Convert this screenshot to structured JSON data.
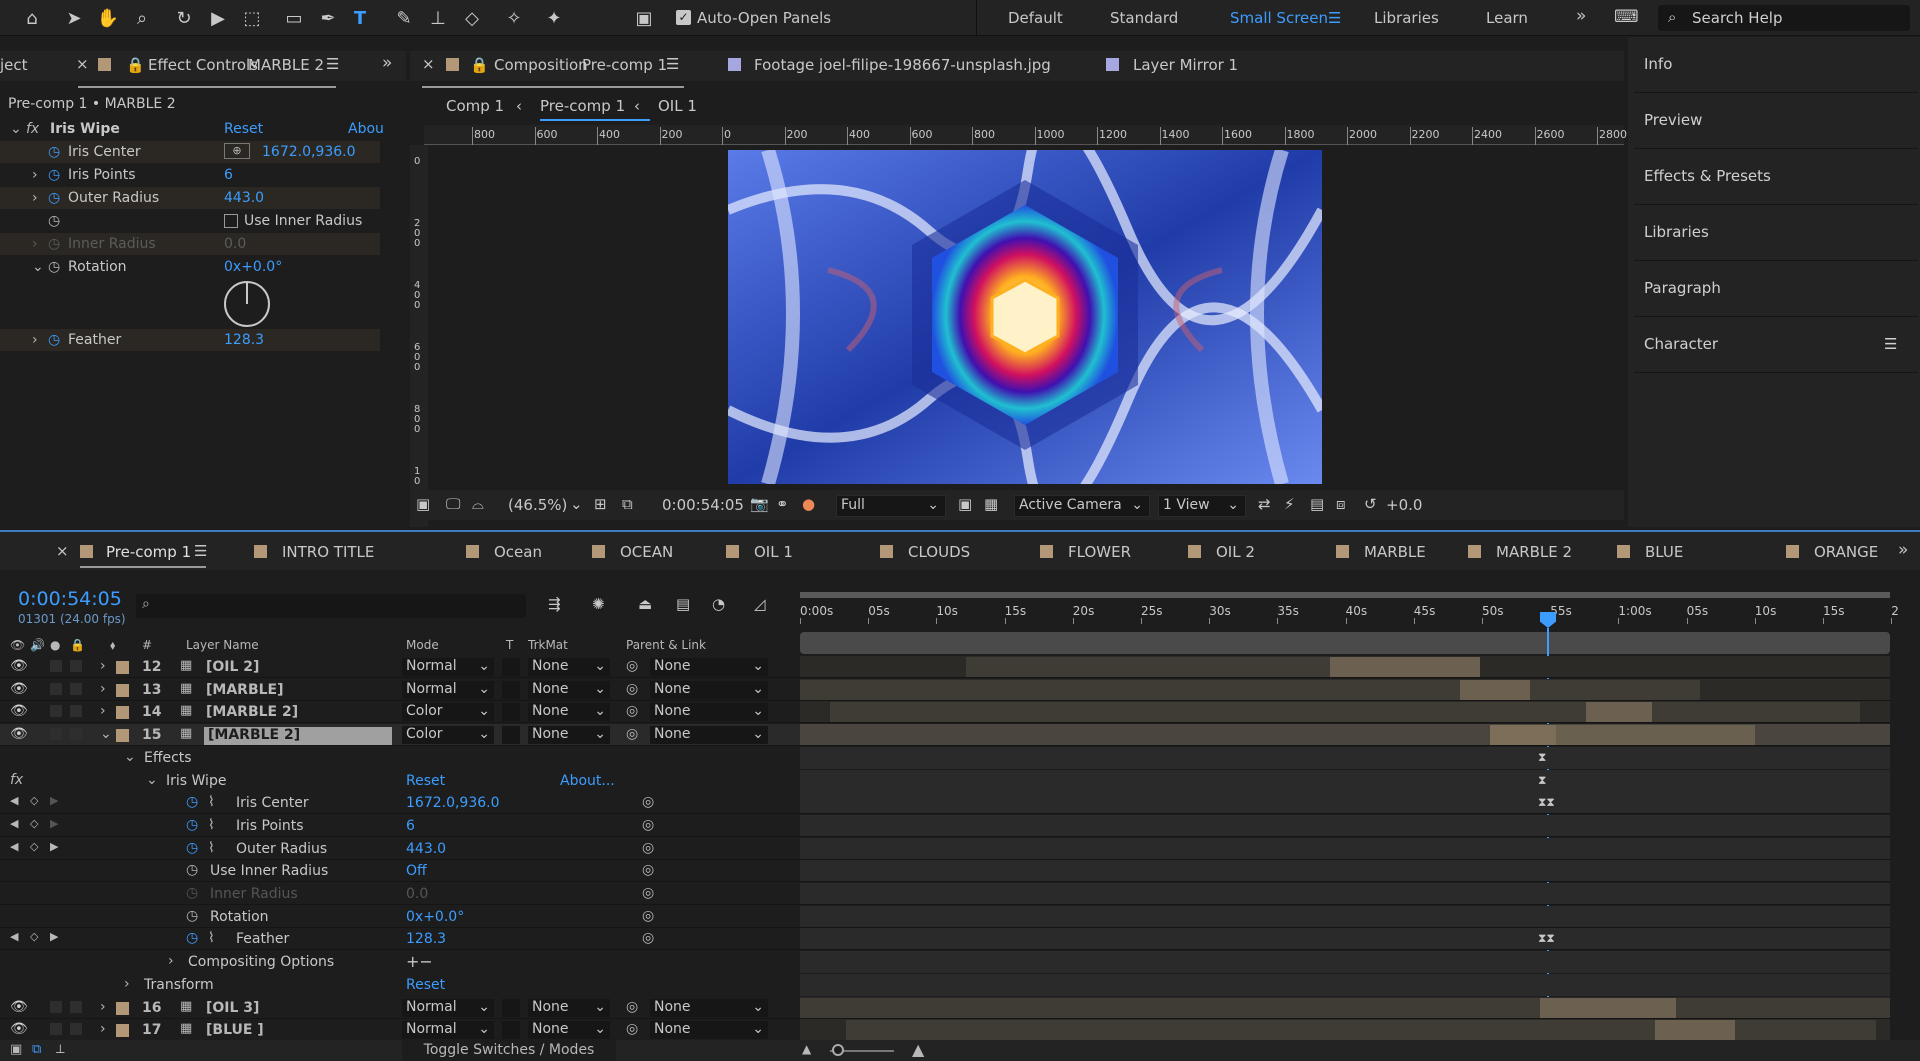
{
  "toolbar": {
    "auto_open_panels": "Auto-Open Panels",
    "workspaces": [
      "Default",
      "Standard",
      "Small Screen",
      "Libraries",
      "Learn"
    ],
    "active_workspace": "Small Screen",
    "search_placeholder": "Search Help"
  },
  "effect_controls": {
    "project_tab": "ject",
    "tab_label": "Effect Controls",
    "tab_layer": "MARBLE 2",
    "breadcrumb": "Pre-comp 1 • MARBLE 2",
    "effect_name": "Iris Wipe",
    "reset": "Reset",
    "about": "Abou",
    "props": [
      {
        "name": "Iris Center",
        "value": "1672.0,936.0"
      },
      {
        "name": "Iris Points",
        "value": "6"
      },
      {
        "name": "Outer Radius",
        "value": "443.0"
      },
      {
        "name": "Use Inner Radius",
        "value": ""
      },
      {
        "name": "Inner Radius",
        "value": "0.0"
      },
      {
        "name": "Rotation",
        "value": "0x+0.0°"
      },
      {
        "name": "Feather",
        "value": "128.3"
      }
    ]
  },
  "composition": {
    "tab_label": "Composition",
    "tab_comp": "Pre-comp 1",
    "footage_tab": "Footage joel-filipe-198667-unsplash.jpg",
    "layer_tab": "Layer Mirror 1",
    "breadcrumbs": [
      "Comp 1",
      "Pre-comp 1",
      "OIL 1"
    ],
    "ruler_labels": [
      "800",
      "600",
      "400",
      "200",
      "0",
      "200",
      "400",
      "600",
      "800",
      "1000",
      "1200",
      "1400",
      "1600",
      "1800",
      "2000",
      "2200",
      "2400",
      "2600",
      "2800"
    ],
    "vruler_labels": [
      "0",
      "2 0 0",
      "4 0 0",
      "6 0 0",
      "8 0 0",
      "1 0"
    ],
    "zoom": "(46.5%)",
    "timecode": "0:00:54:05",
    "resolution": "Full",
    "camera": "Active Camera",
    "views": "1 View",
    "exposure": "+0.0"
  },
  "right_panels": [
    "Info",
    "Preview",
    "Effects & Presets",
    "Libraries",
    "Paragraph",
    "Character"
  ],
  "timeline": {
    "tabs": [
      "Pre-comp 1",
      "INTRO TITLE",
      "Ocean",
      "OCEAN",
      "OIL 1",
      "CLOUDS",
      "FLOWER",
      "OIL 2",
      "MARBLE",
      "MARBLE 2",
      "BLUE",
      "ORANGE"
    ],
    "timecode": "0:00:54:05",
    "frame_info": "01301 (24.00 fps)",
    "col_hash": "#",
    "col_layer_name": "Layer Name",
    "col_mode": "Mode",
    "col_t": "T",
    "col_trkmat": "TrkMat",
    "col_parent": "Parent & Link",
    "ruler": [
      "0:00s",
      "05s",
      "10s",
      "15s",
      "20s",
      "25s",
      "30s",
      "35s",
      "40s",
      "45s",
      "50s",
      "55s",
      "1:00s",
      "05s",
      "10s",
      "15s",
      "2"
    ],
    "layers_top": [
      {
        "num": "12",
        "name": "[OIL 2]",
        "mode": "Normal",
        "trkmat": "None",
        "parent": "None"
      },
      {
        "num": "13",
        "name": "[MARBLE]",
        "mode": "Normal",
        "trkmat": "None",
        "parent": "None"
      },
      {
        "num": "14",
        "name": "[MARBLE 2]",
        "mode": "Color",
        "trkmat": "None",
        "parent": "None"
      },
      {
        "num": "15",
        "name": "[MARBLE 2]",
        "mode": "Color",
        "trkmat": "None",
        "parent": "None"
      }
    ],
    "effects_label": "Effects",
    "effect_name": "Iris Wipe",
    "reset": "Reset",
    "about": "About...",
    "props": [
      {
        "name": "Iris Center",
        "value": "1672.0,936.0"
      },
      {
        "name": "Iris Points",
        "value": "6"
      },
      {
        "name": "Outer Radius",
        "value": "443.0"
      },
      {
        "name": "Use Inner Radius",
        "value": "Off"
      },
      {
        "name": "Inner Radius",
        "value": "0.0"
      },
      {
        "name": "Rotation",
        "value": "0x+0.0°"
      },
      {
        "name": "Feather",
        "value": "128.3"
      }
    ],
    "compositing_options": "Compositing Options",
    "transform": "Transform",
    "transform_reset": "Reset",
    "layers_bottom": [
      {
        "num": "16",
        "name": "[OIL 3]",
        "mode": "Normal",
        "trkmat": "None",
        "parent": "None"
      },
      {
        "num": "17",
        "name": "[BLUE ]",
        "mode": "Normal",
        "trkmat": "None",
        "parent": "None"
      }
    ],
    "toggle_label": "Toggle Switches / Modes"
  },
  "colors": {
    "accent": "#3c9dff",
    "label": "#b29876",
    "bg": "#1d1d1d",
    "panel": "#232323"
  }
}
